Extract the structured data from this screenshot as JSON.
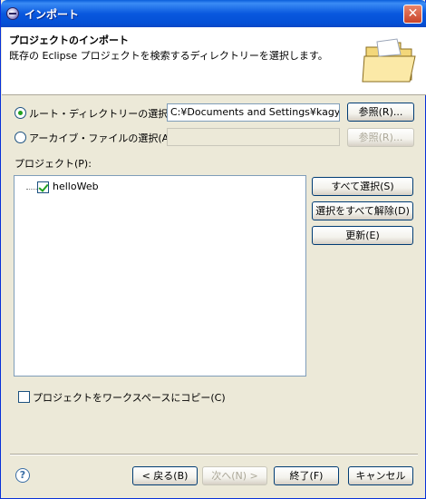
{
  "window": {
    "title": "インポート",
    "close_glyph": "✕"
  },
  "banner": {
    "title": "プロジェクトのインポート",
    "description": "既存の Eclipse プロジェクトを検索するディレクトリーを選択します。"
  },
  "source": {
    "root_dir_label": "ルート・ディレクトリーの選択(T):",
    "root_dir_value": "C:¥Documents and Settings¥kagyuu¥",
    "root_dir_selected": true,
    "archive_label": "アーカイブ・ファイルの選択(A):",
    "archive_value": "",
    "browse_label": "参照(R)..."
  },
  "projects": {
    "label": "プロジェクト(P):",
    "items": [
      {
        "name": "helloWeb",
        "checked": true
      }
    ],
    "select_all": "すべて選択(S)",
    "deselect_all": "選択をすべて解除(D)",
    "refresh": "更新(E)"
  },
  "copy_option": {
    "label": "プロジェクトをワークスペースにコピー(C)",
    "checked": false
  },
  "footer": {
    "back": "< 戻る(B)",
    "next": "次へ(N) >",
    "finish": "終了(F)",
    "cancel": "キャンセル",
    "help_glyph": "?"
  }
}
